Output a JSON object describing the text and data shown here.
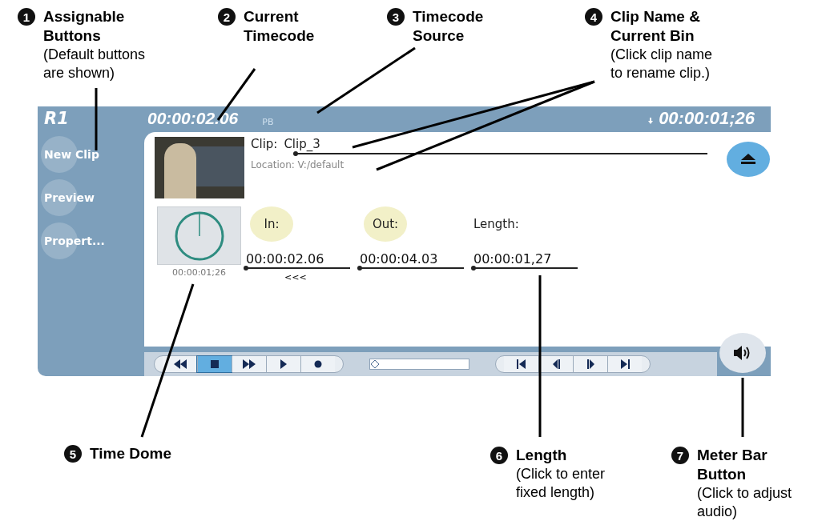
{
  "callouts": [
    {
      "number": "1",
      "title": [
        "Assignable",
        "Buttons"
      ],
      "note": [
        "(Default buttons",
        "are shown)"
      ]
    },
    {
      "number": "2",
      "title": [
        "Current",
        "Timecode"
      ]
    },
    {
      "number": "3",
      "title": [
        "Timecode",
        "Source"
      ]
    },
    {
      "number": "4",
      "title": [
        "Clip Name &",
        "Current Bin"
      ],
      "note": [
        "(Click clip name",
        "to rename clip.)"
      ]
    },
    {
      "number": "5",
      "title": [
        "Time Dome"
      ]
    },
    {
      "number": "6",
      "title": [
        "Length"
      ],
      "note": [
        "(Click to enter",
        "fixed length)"
      ]
    },
    {
      "number": "7",
      "title": [
        "Meter Bar",
        "Button"
      ],
      "note": [
        "(Click to adjust",
        "audio)"
      ]
    }
  ],
  "panel": {
    "header": {
      "channel": "R1",
      "timecode": "00:00:02.06",
      "source": "PB",
      "duration": "00:00:01;26"
    },
    "buttons": [
      {
        "label": "New Clip"
      },
      {
        "label": "Preview"
      },
      {
        "label": "Propert..."
      }
    ],
    "clip": {
      "label": "Clip:",
      "name": "Clip_3",
      "location": "Location: V:/default"
    },
    "time_dome": {
      "reading": "00:00:01;26"
    },
    "marks": [
      {
        "kind": "in",
        "label": "In:",
        "value": "00:00:02.06",
        "hint": "<<<"
      },
      {
        "kind": "out",
        "label": "Out:",
        "value": "00:00:04.03"
      },
      {
        "kind": "length",
        "label": "Length:",
        "value": "00:00:01,27"
      }
    ],
    "transport": [
      {
        "kind": "rewind",
        "selected": false
      },
      {
        "kind": "stop",
        "selected": true
      },
      {
        "kind": "fast-forward",
        "selected": false
      },
      {
        "kind": "play",
        "selected": false
      },
      {
        "kind": "record",
        "selected": false
      }
    ],
    "shuttle": {
      "level": 0
    },
    "jog": [
      {
        "kind": "start"
      },
      {
        "kind": "step-back"
      },
      {
        "kind": "step-forward"
      },
      {
        "kind": "end"
      }
    ]
  }
}
